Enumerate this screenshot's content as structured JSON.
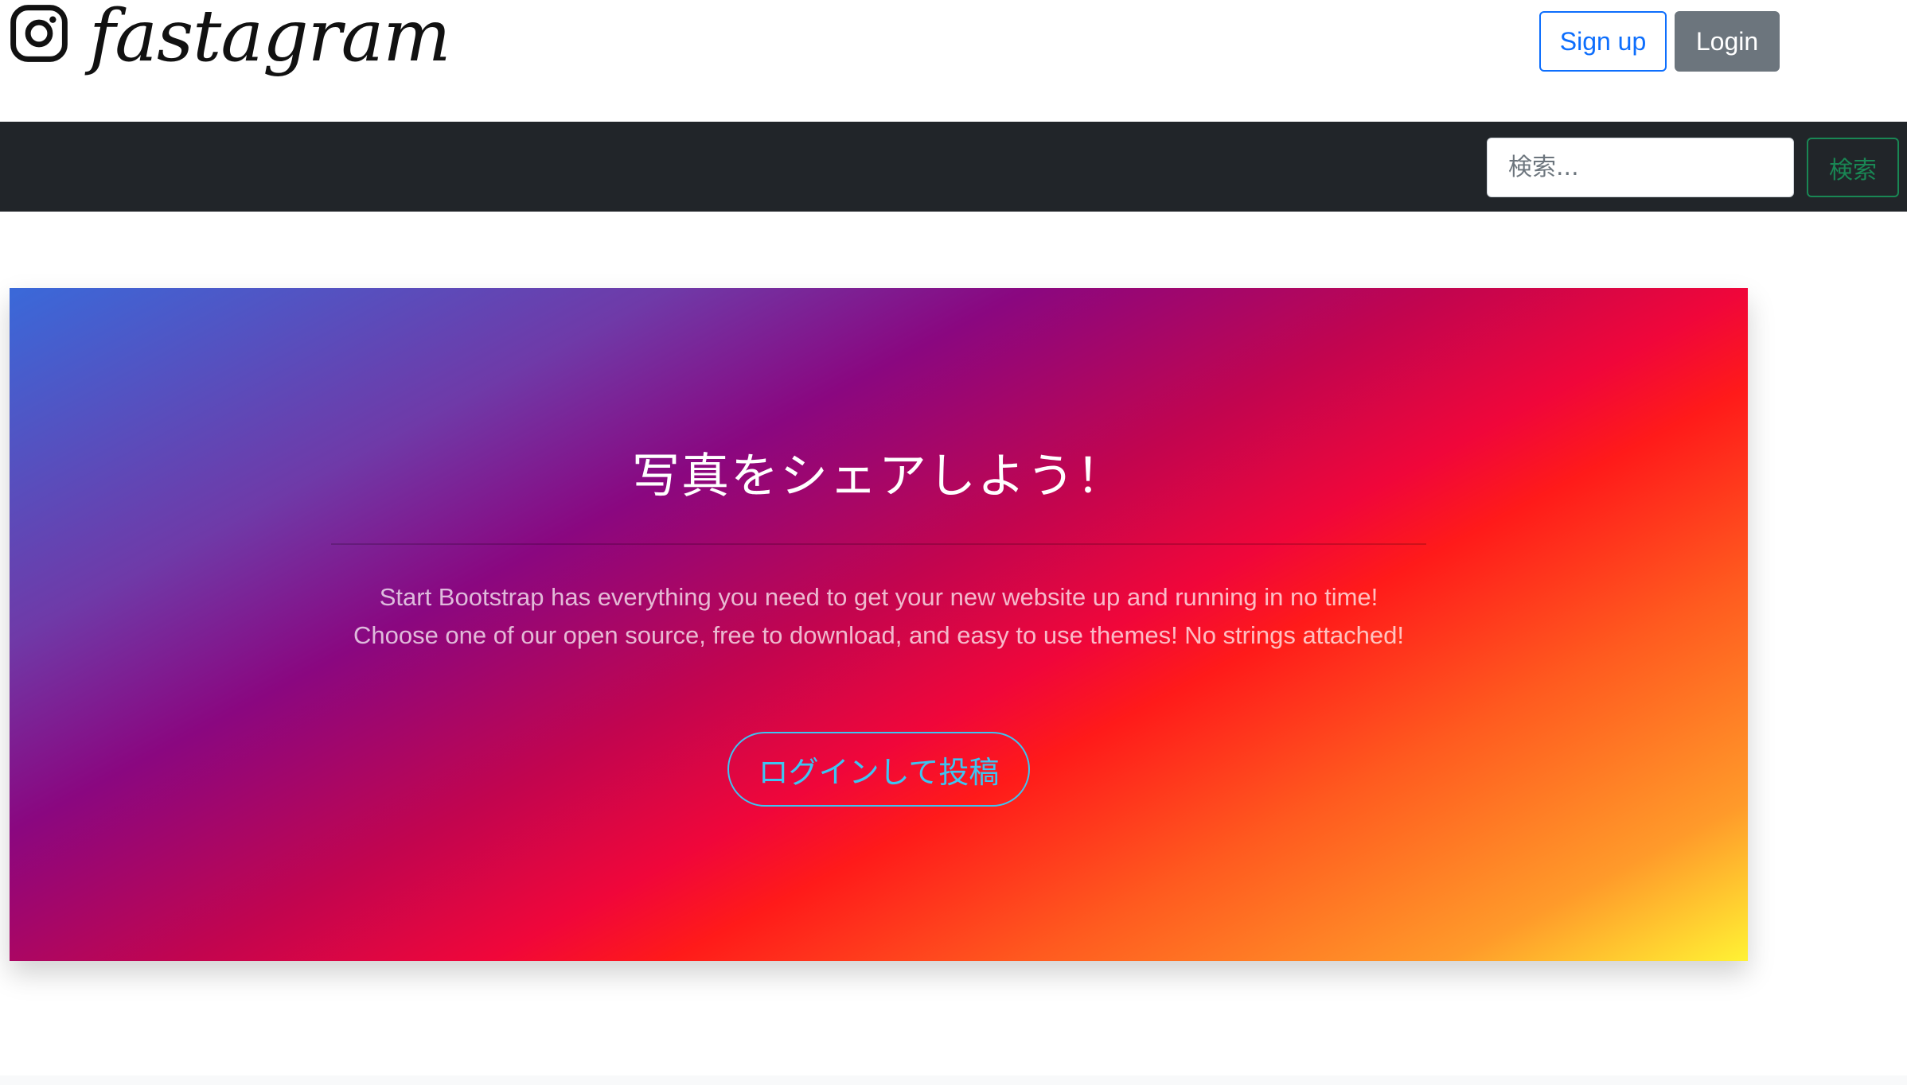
{
  "header": {
    "brand_name": "fastagram",
    "signup_label": "Sign up",
    "login_label": "Login"
  },
  "navbar": {
    "search_placeholder": "検索...",
    "search_button_label": "検索"
  },
  "hero": {
    "title": "写真をシェアしよう！",
    "description": "Start Bootstrap has everything you need to get your new website up and running in no time! Choose one of our open source, free to download, and easy to use themes! No strings attached!",
    "cta_label": "ログインして投稿"
  },
  "colors": {
    "navbar_bg": "#212529",
    "signup_accent": "#0d6efd",
    "login_bg": "#6c757d",
    "search_button": "#198754",
    "cta_outline": "#3dc5f2"
  },
  "icons": {
    "brand_icon": "instagram-icon"
  }
}
